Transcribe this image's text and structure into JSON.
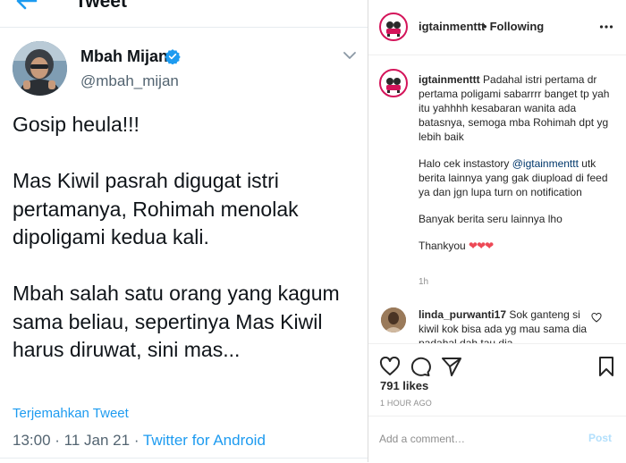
{
  "tweet": {
    "header_title": "Tweet",
    "author": {
      "name": "Mbah Mijan",
      "handle": "@mbah_mijan"
    },
    "paragraphs": [
      "Gosip heula!!!",
      "Mas Kiwil pasrah digugat istri pertamanya, Rohimah menolak dipoligami kedua kali.",
      "Mbah salah satu orang yang kagum sama beliau, sepertinya Mas Kiwil harus diruwat, sini mas..."
    ],
    "translate_label": "Terjemahkan Tweet",
    "time": "13:00",
    "date": "11 Jan 21",
    "source": "Twitter for Android",
    "icons": {
      "back": "back-arrow-icon",
      "verified": "verified-badge-icon",
      "menu": "chevron-down-icon"
    }
  },
  "instagram": {
    "username": "igtainmenttt",
    "follow_status": "Following",
    "caption_user": "igtainmenttt",
    "caption_parts": {
      "p1": "Padahal istri pertama dr pertama poligami sabarrrr banget tp yah itu yahhhh kesabaran wanita ada batasnya, semoga mba Rohimah dpt yg lebih baik",
      "p2_pre": "Halo cek instastory ",
      "p2_mention": "@igtainmenttt",
      "p2_post": " utk berita lainnya yang gak diupload di feed ya dan jgn lupa turn on notification",
      "p3": "Banyak berita seru lainnya lho",
      "p4": "Thankyou",
      "hearts": "❤❤❤"
    },
    "caption_time": "1h",
    "comment": {
      "user": "linda_purwanti17",
      "text": "Sok ganteng si kiwil kok bisa ada yg mau sama dia padahal dah tau dia"
    },
    "likes": "791 likes",
    "posted_ago": "1 HOUR AGO",
    "comment_placeholder": "Add a comment…",
    "post_label": "Post",
    "colors": {
      "ring": "#d4145a",
      "link": "#00376b",
      "post_disabled": "#b2dffc",
      "heart": "#ed4956"
    }
  }
}
